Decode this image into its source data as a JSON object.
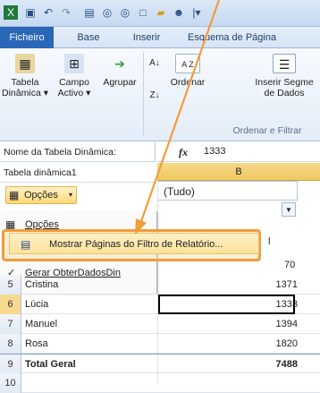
{
  "ribbon": {
    "tabs": [
      "Ficheiro",
      "Base",
      "Inserir",
      "Esquema de Página"
    ],
    "buttons": {
      "tabela": "Tabela\nDinâmica ▾",
      "campo": "Campo\nActivo ▾",
      "agrupar": "Agrupar",
      "ordenar": "Ordenar",
      "segmentacao": "Inserir Segme\nde Dados"
    },
    "group_label": "Ordenar e Filtrar"
  },
  "formula_bar": {
    "namebox": "Nome da Tabela Dinâmica:",
    "fx": "fx",
    "value": "1333"
  },
  "pivot": {
    "name": "Tabela dinâmica1",
    "options_label": "Opções"
  },
  "column_header": "B",
  "filter_cell": "(Tudo)",
  "menu": {
    "opcoes": "Opções",
    "mostrar": "Mostrar Páginas do Filtro de Relatório...",
    "gerar": "Gerar ObterDadosDin",
    "check": "✓"
  },
  "rows": [
    {
      "num": "5",
      "name": "Cristina",
      "value": "1371"
    },
    {
      "num": "6",
      "name": "Lúcia",
      "value": "1333"
    },
    {
      "num": "7",
      "name": "Manuel",
      "value": "1394"
    },
    {
      "num": "8",
      "name": "Rosa",
      "value": "1820"
    },
    {
      "num": "9",
      "name": "Total Geral",
      "value": "7488"
    },
    {
      "num": "10",
      "name": "",
      "value": ""
    }
  ],
  "partial": {
    "top_value": "l",
    "second_value": "70"
  },
  "colors": {
    "accent": "#f29c3a",
    "file_tab": "#2a67b8",
    "header": "#f0c860"
  }
}
